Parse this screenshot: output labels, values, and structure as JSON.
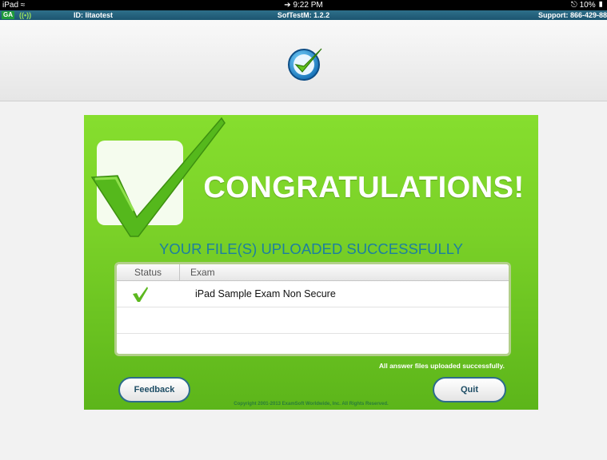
{
  "status_bar": {
    "device": "iPad",
    "time": "9:22 PM",
    "battery": "10%"
  },
  "info_bar": {
    "ga": "GA",
    "user_id": "ID: litaotest",
    "version": "SofTestM: 1.2.2",
    "support": "Support: 866-429-88"
  },
  "panel": {
    "heading": "CONGRATULATIONS!",
    "subheading": "YOUR FILE(S) UPLOADED SUCCESSFULLY",
    "table": {
      "col_status": "Status",
      "col_exam": "Exam",
      "rows": [
        {
          "status": "uploaded",
          "exam": "iPad Sample Exam Non Secure"
        }
      ]
    },
    "note": "All answer files uploaded successfully.",
    "feedback_label": "Feedback",
    "quit_label": "Quit",
    "copyright": "Copyright 2001-2013 ExamSoft Worldwide, Inc. All Rights Reserved."
  },
  "colors": {
    "panel_green": "#7ad128",
    "subheading_blue": "#1c7fa0",
    "button_border": "#2c6c8c"
  }
}
